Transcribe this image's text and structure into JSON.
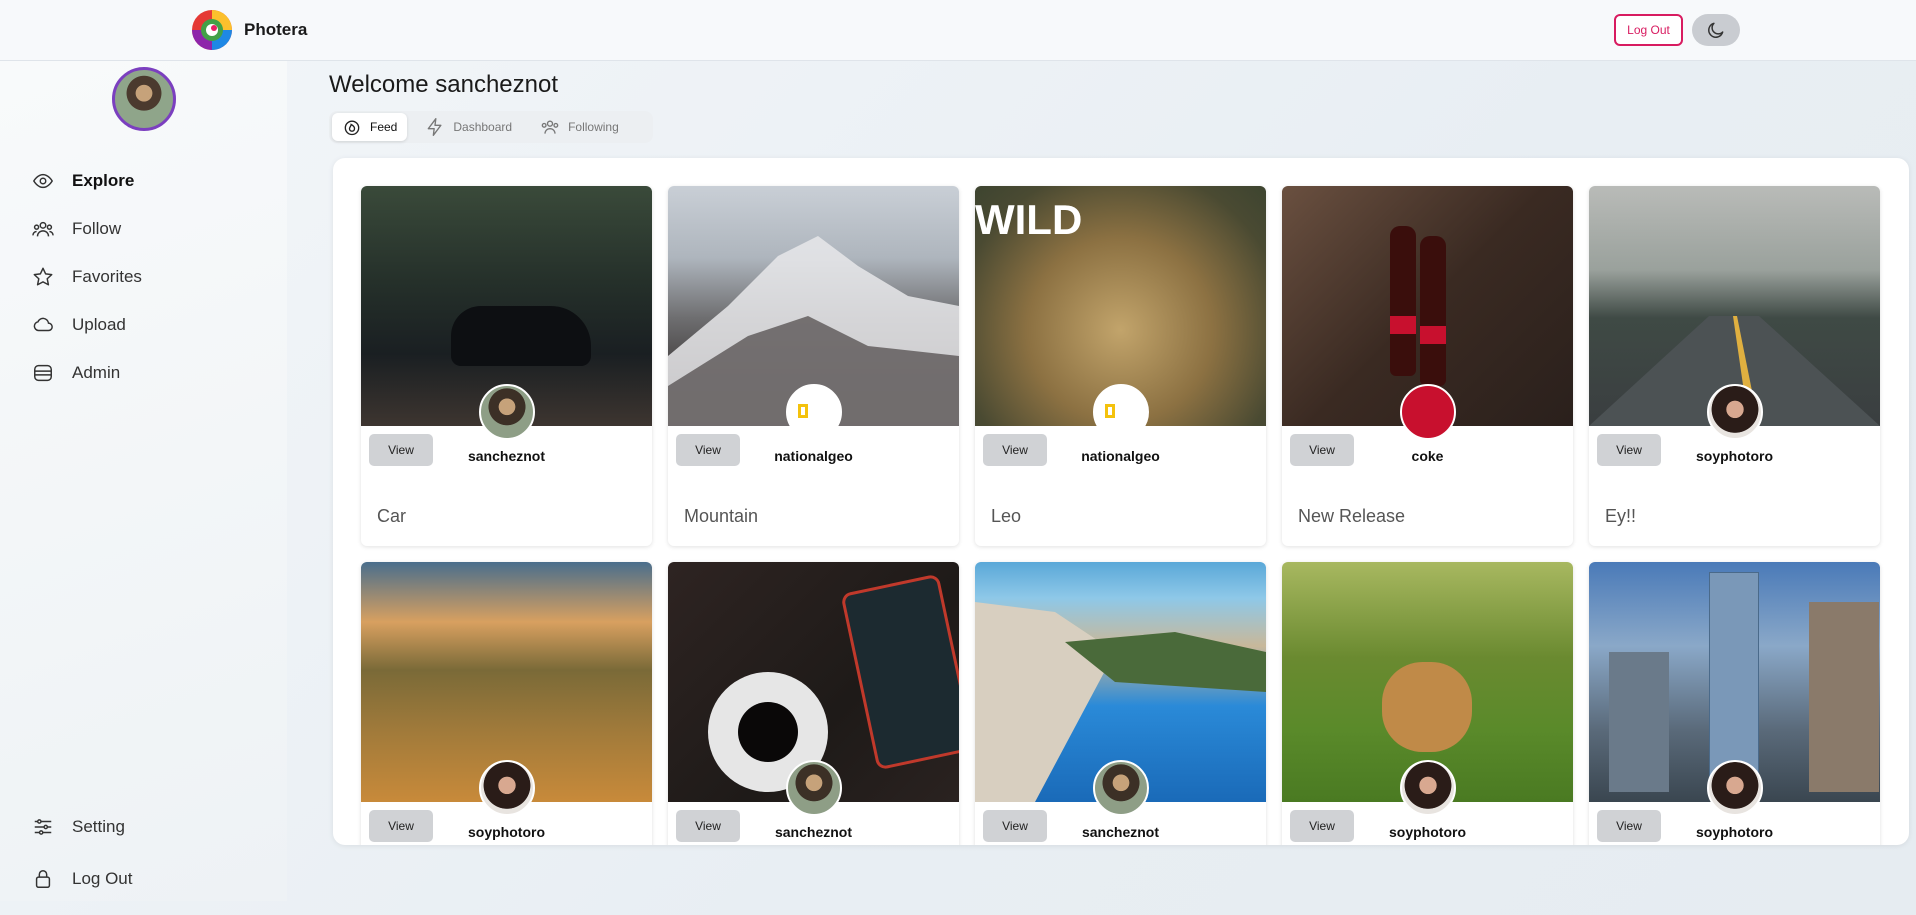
{
  "header": {
    "app_name": "Photera",
    "logout_label": "Log Out",
    "theme_icon": "moon-icon"
  },
  "sidebar": {
    "items": [
      {
        "label": "Explore",
        "icon": "eye-icon",
        "active": true
      },
      {
        "label": "Follow",
        "icon": "users-icon"
      },
      {
        "label": "Favorites",
        "icon": "star-icon"
      },
      {
        "label": "Upload",
        "icon": "cloud-icon"
      },
      {
        "label": "Admin",
        "icon": "database-icon"
      }
    ],
    "bottom_items": [
      {
        "label": "Setting",
        "icon": "sliders-icon"
      },
      {
        "label": "Log Out",
        "icon": "lock-icon"
      }
    ]
  },
  "main": {
    "welcome": "Welcome sancheznot",
    "tabs": [
      {
        "label": "Feed",
        "icon": "flame-icon",
        "active": true
      },
      {
        "label": "Dashboard",
        "icon": "lightning-icon"
      },
      {
        "label": "Following",
        "icon": "users-icon"
      }
    ]
  },
  "feed": {
    "view_label": "View",
    "cards": [
      {
        "title": "Car",
        "user": "sancheznot"
      },
      {
        "title": "Mountain",
        "user": "nationalgeo"
      },
      {
        "title": "Leo",
        "user": "nationalgeo",
        "overlay_text": "WILD"
      },
      {
        "title": "New Release",
        "user": "coke"
      },
      {
        "title": "Ey!!",
        "user": "soyphotoro"
      },
      {
        "title": "",
        "user": "soyphotoro"
      },
      {
        "title": "",
        "user": "sancheznot"
      },
      {
        "title": "",
        "user": "sancheznot"
      },
      {
        "title": "",
        "user": "soyphotoro"
      },
      {
        "title": "",
        "user": "soyphotoro"
      }
    ]
  },
  "colors": {
    "accent": "#d81b60",
    "avatar_ring": "#7b3fbf"
  }
}
